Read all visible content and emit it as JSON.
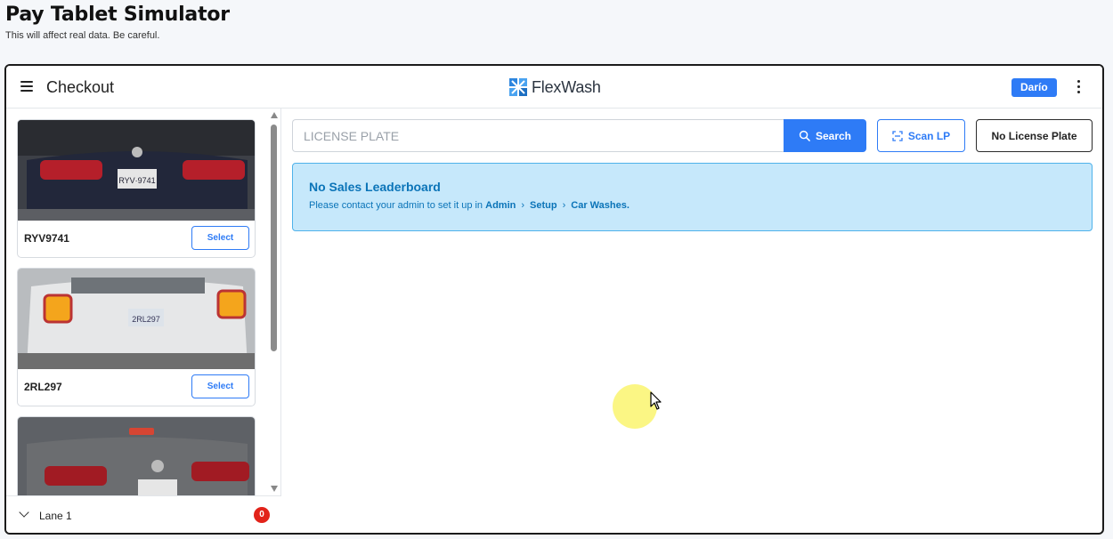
{
  "page": {
    "title": "Pay Tablet Simulator",
    "warning": "This will affect real data. Be careful."
  },
  "topbar": {
    "title": "Checkout",
    "brand": "FlexWash",
    "user": "Darío"
  },
  "vehicles": [
    {
      "plate": "RYV9741",
      "select_label": "Select",
      "photo": "gray Honda sedan rear with Texas plate"
    },
    {
      "plate": "2RL297",
      "select_label": "Select",
      "photo": "white Jeep rear with Texas plate"
    },
    {
      "plate": "",
      "select_label": "",
      "photo": "gray Toyota sedan rear with Texas plate"
    }
  ],
  "lane": {
    "label": "Lane 1",
    "count": "0"
  },
  "search": {
    "placeholder": "LICENSE PLATE",
    "button_label": "Search",
    "scan_label": "Scan LP",
    "no_plate_label": "No License Plate"
  },
  "alert": {
    "title": "No Sales Leaderboard",
    "message_prefix": "Please contact your admin to set it up in",
    "crumbs": [
      "Admin",
      "Setup",
      "Car Washes."
    ]
  },
  "colors": {
    "accent": "#2e7bf6",
    "alert_bg": "#c6e8fb",
    "alert_border": "#4fb2ea",
    "alert_text": "#0b74b8",
    "badge_red": "#e2231a"
  },
  "icons": [
    "menu-icon",
    "flexwash-logo-icon",
    "kebab-menu-icon",
    "search-icon",
    "scan-icon",
    "chevron-down-icon",
    "chevron-right-icon"
  ]
}
